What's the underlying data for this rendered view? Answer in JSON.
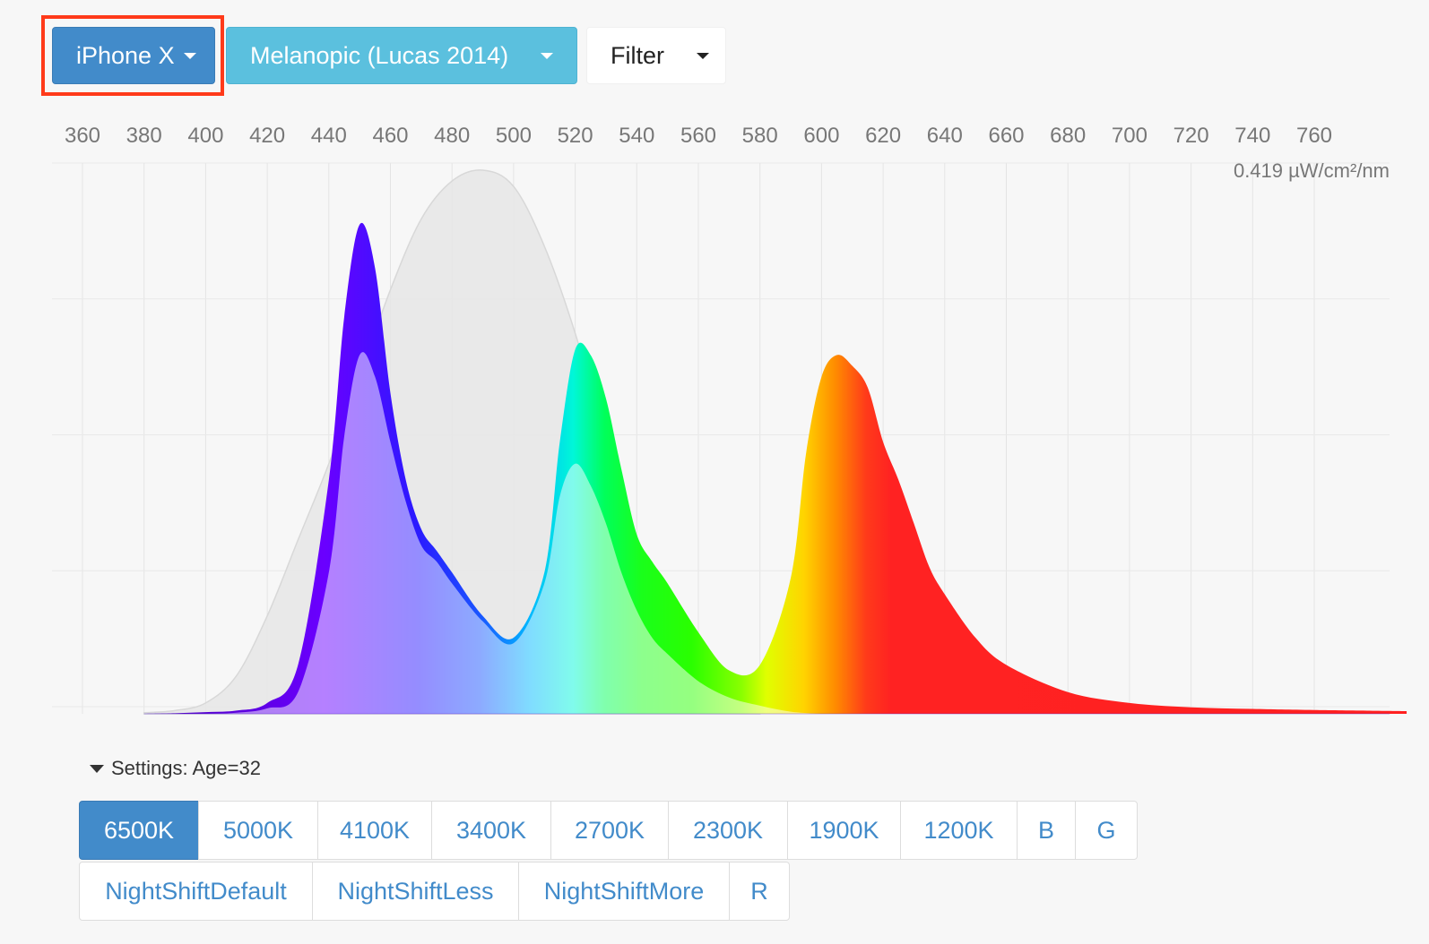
{
  "toolbar": {
    "device_label": "iPhone X",
    "curve_label": "Melanopic (Lucas 2014)",
    "filter_label": "Filter"
  },
  "settings": {
    "label": "Settings: Age=32"
  },
  "presets": {
    "row1": [
      {
        "label": "6500K",
        "active": true
      },
      {
        "label": "5000K"
      },
      {
        "label": "4100K"
      },
      {
        "label": "3400K"
      },
      {
        "label": "2700K"
      },
      {
        "label": "2300K"
      },
      {
        "label": "1900K"
      },
      {
        "label": "1200K"
      },
      {
        "label": "B"
      },
      {
        "label": "G"
      }
    ],
    "row2": [
      {
        "label": "NightShiftDefault"
      },
      {
        "label": "NightShiftLess"
      },
      {
        "label": "NightShiftMore"
      },
      {
        "label": "R"
      }
    ]
  },
  "chart_data": {
    "type": "area",
    "xlim": [
      360,
      790
    ],
    "x_ticks": [
      360,
      380,
      400,
      420,
      440,
      460,
      480,
      500,
      520,
      540,
      560,
      580,
      600,
      620,
      640,
      660,
      680,
      700,
      720,
      740,
      760
    ],
    "max_label": "0.419 µW/cm²/nm",
    "series": [
      {
        "role": "sensitivity",
        "color": "#e6e6e6",
        "x": [
          380,
          390,
          400,
          410,
          420,
          430,
          440,
          450,
          460,
          470,
          480,
          490,
          500,
          510,
          520,
          530,
          540,
          550,
          560,
          570,
          580
        ],
        "y": [
          0.002,
          0.006,
          0.02,
          0.07,
          0.18,
          0.32,
          0.46,
          0.62,
          0.78,
          0.91,
          0.98,
          1.0,
          0.97,
          0.86,
          0.7,
          0.5,
          0.3,
          0.16,
          0.07,
          0.02,
          0.005
        ]
      },
      {
        "role": "spectrum",
        "x": [
          380,
          390,
          400,
          410,
          420,
          430,
          440,
          445,
          450,
          455,
          460,
          465,
          470,
          475,
          480,
          490,
          500,
          510,
          515,
          520,
          525,
          530,
          535,
          540,
          545,
          550,
          560,
          570,
          580,
          590,
          595,
          600,
          605,
          610,
          615,
          620,
          625,
          630,
          635,
          640,
          650,
          660,
          680,
          700,
          720,
          740,
          760,
          790
        ],
        "y": [
          0.0,
          0.001,
          0.003,
          0.006,
          0.02,
          0.09,
          0.43,
          0.73,
          0.9,
          0.82,
          0.59,
          0.43,
          0.34,
          0.3,
          0.26,
          0.18,
          0.14,
          0.26,
          0.5,
          0.67,
          0.66,
          0.58,
          0.45,
          0.33,
          0.28,
          0.24,
          0.15,
          0.08,
          0.09,
          0.25,
          0.48,
          0.62,
          0.66,
          0.64,
          0.6,
          0.5,
          0.43,
          0.35,
          0.27,
          0.22,
          0.14,
          0.09,
          0.04,
          0.02,
          0.012,
          0.009,
          0.007,
          0.005
        ]
      },
      {
        "role": "weighted",
        "x": [
          380,
          390,
          400,
          410,
          420,
          430,
          440,
          445,
          450,
          455,
          460,
          465,
          470,
          475,
          480,
          490,
          500,
          510,
          515,
          520,
          525,
          530,
          535,
          540,
          545,
          550,
          560,
          570,
          580,
          590,
          600
        ],
        "y": [
          0.0,
          0.0,
          0.0,
          0.002,
          0.01,
          0.04,
          0.26,
          0.51,
          0.66,
          0.62,
          0.5,
          0.39,
          0.31,
          0.28,
          0.24,
          0.17,
          0.13,
          0.24,
          0.4,
          0.46,
          0.42,
          0.35,
          0.26,
          0.19,
          0.14,
          0.11,
          0.06,
          0.03,
          0.015,
          0.004,
          0.0
        ]
      }
    ]
  }
}
